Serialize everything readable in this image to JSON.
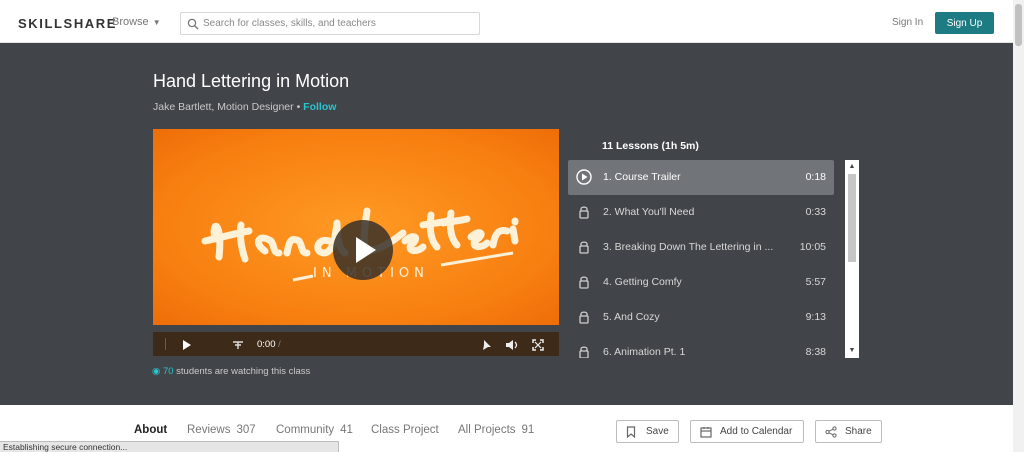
{
  "header": {
    "logo": "SKILLSHARE",
    "browse_label": "Browse",
    "search_placeholder": "Search for classes, skills, and teachers",
    "signin_label": "Sign In",
    "signup_label": "Sign Up",
    "accent_color": "#1c7b83"
  },
  "class": {
    "title": "Hand Lettering in Motion",
    "teacher": "Jake Bartlett, Motion Designer",
    "separator": " • ",
    "follow_label": "Follow",
    "video": {
      "current_time": "0:00",
      "duration_separator": " / "
    },
    "watching_count": "70",
    "watching_text": " students are watching this class"
  },
  "lessons": {
    "header": "11 Lessons (1h 5m)",
    "items": [
      {
        "label": "1. Course Trailer",
        "duration": "0:18",
        "icon": "play-circle-icon",
        "active": true
      },
      {
        "label": "2. What You'll Need",
        "duration": "0:33",
        "icon": "lock-icon",
        "active": false
      },
      {
        "label": "3. Breaking Down The Lettering in ...",
        "duration": "10:05",
        "icon": "lock-icon",
        "active": false
      },
      {
        "label": "4. Getting Comfy",
        "duration": "5:57",
        "icon": "lock-icon",
        "active": false
      },
      {
        "label": "5. And Cozy",
        "duration": "9:13",
        "icon": "lock-icon",
        "active": false
      },
      {
        "label": "6. Animation Pt. 1",
        "duration": "8:38",
        "icon": "lock-icon",
        "active": false
      }
    ]
  },
  "tabs": [
    {
      "label": "About",
      "count": ""
    },
    {
      "label": "Reviews",
      "count": "307"
    },
    {
      "label": "Community",
      "count": "41"
    },
    {
      "label": "Class Project",
      "count": ""
    },
    {
      "label": "All Projects",
      "count": "91"
    }
  ],
  "actions": {
    "save": "Save",
    "calendar": "Add to Calendar",
    "share": "Share"
  },
  "status_text": "Establishing secure connection..."
}
